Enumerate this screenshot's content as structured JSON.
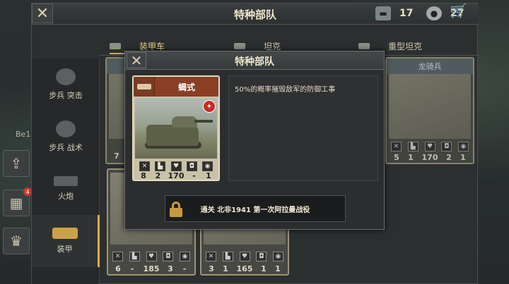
{
  "window": {
    "title": "特种部队",
    "resources": {
      "tanks": "17",
      "medals": "27"
    }
  },
  "tabs": [
    {
      "label": "装甲车",
      "active": true
    },
    {
      "label": "坦克",
      "active": false
    },
    {
      "label": "重型坦克",
      "active": false
    }
  ],
  "sidebar": {
    "items": [
      {
        "label": "步兵 突击",
        "icon": "helmet-icon"
      },
      {
        "label": "步兵 战术",
        "icon": "helmet-icon"
      },
      {
        "label": "火炮",
        "icon": "artillery-icon"
      },
      {
        "label": "装甲",
        "icon": "tank-icon",
        "active": true
      }
    ]
  },
  "background": {
    "side_text": "Be1",
    "badge": "4",
    "cards": [
      {
        "name": "",
        "stats": [
          "7",
          "",
          "",
          "",
          ""
        ]
      },
      {
        "name": "龙骑兵",
        "stats": [
          "5",
          "1",
          "170",
          "2",
          "1"
        ]
      },
      {
        "name": "",
        "stats": [
          "6",
          "-",
          "185",
          "3",
          "-"
        ]
      },
      {
        "name": "",
        "stats": [
          "3",
          "1",
          "165",
          "1",
          "1"
        ]
      }
    ],
    "roman": "IV"
  },
  "modal": {
    "title": "特种部队",
    "unit": {
      "name": "蝎式",
      "nation_color": "#c7291f",
      "stats": [
        "8",
        "2",
        "170",
        "-",
        "1"
      ]
    },
    "description": "50%的概率摧毁敌军的防御工事",
    "unlock_text": "通关  北非1941  第一次阿拉曼战役"
  }
}
